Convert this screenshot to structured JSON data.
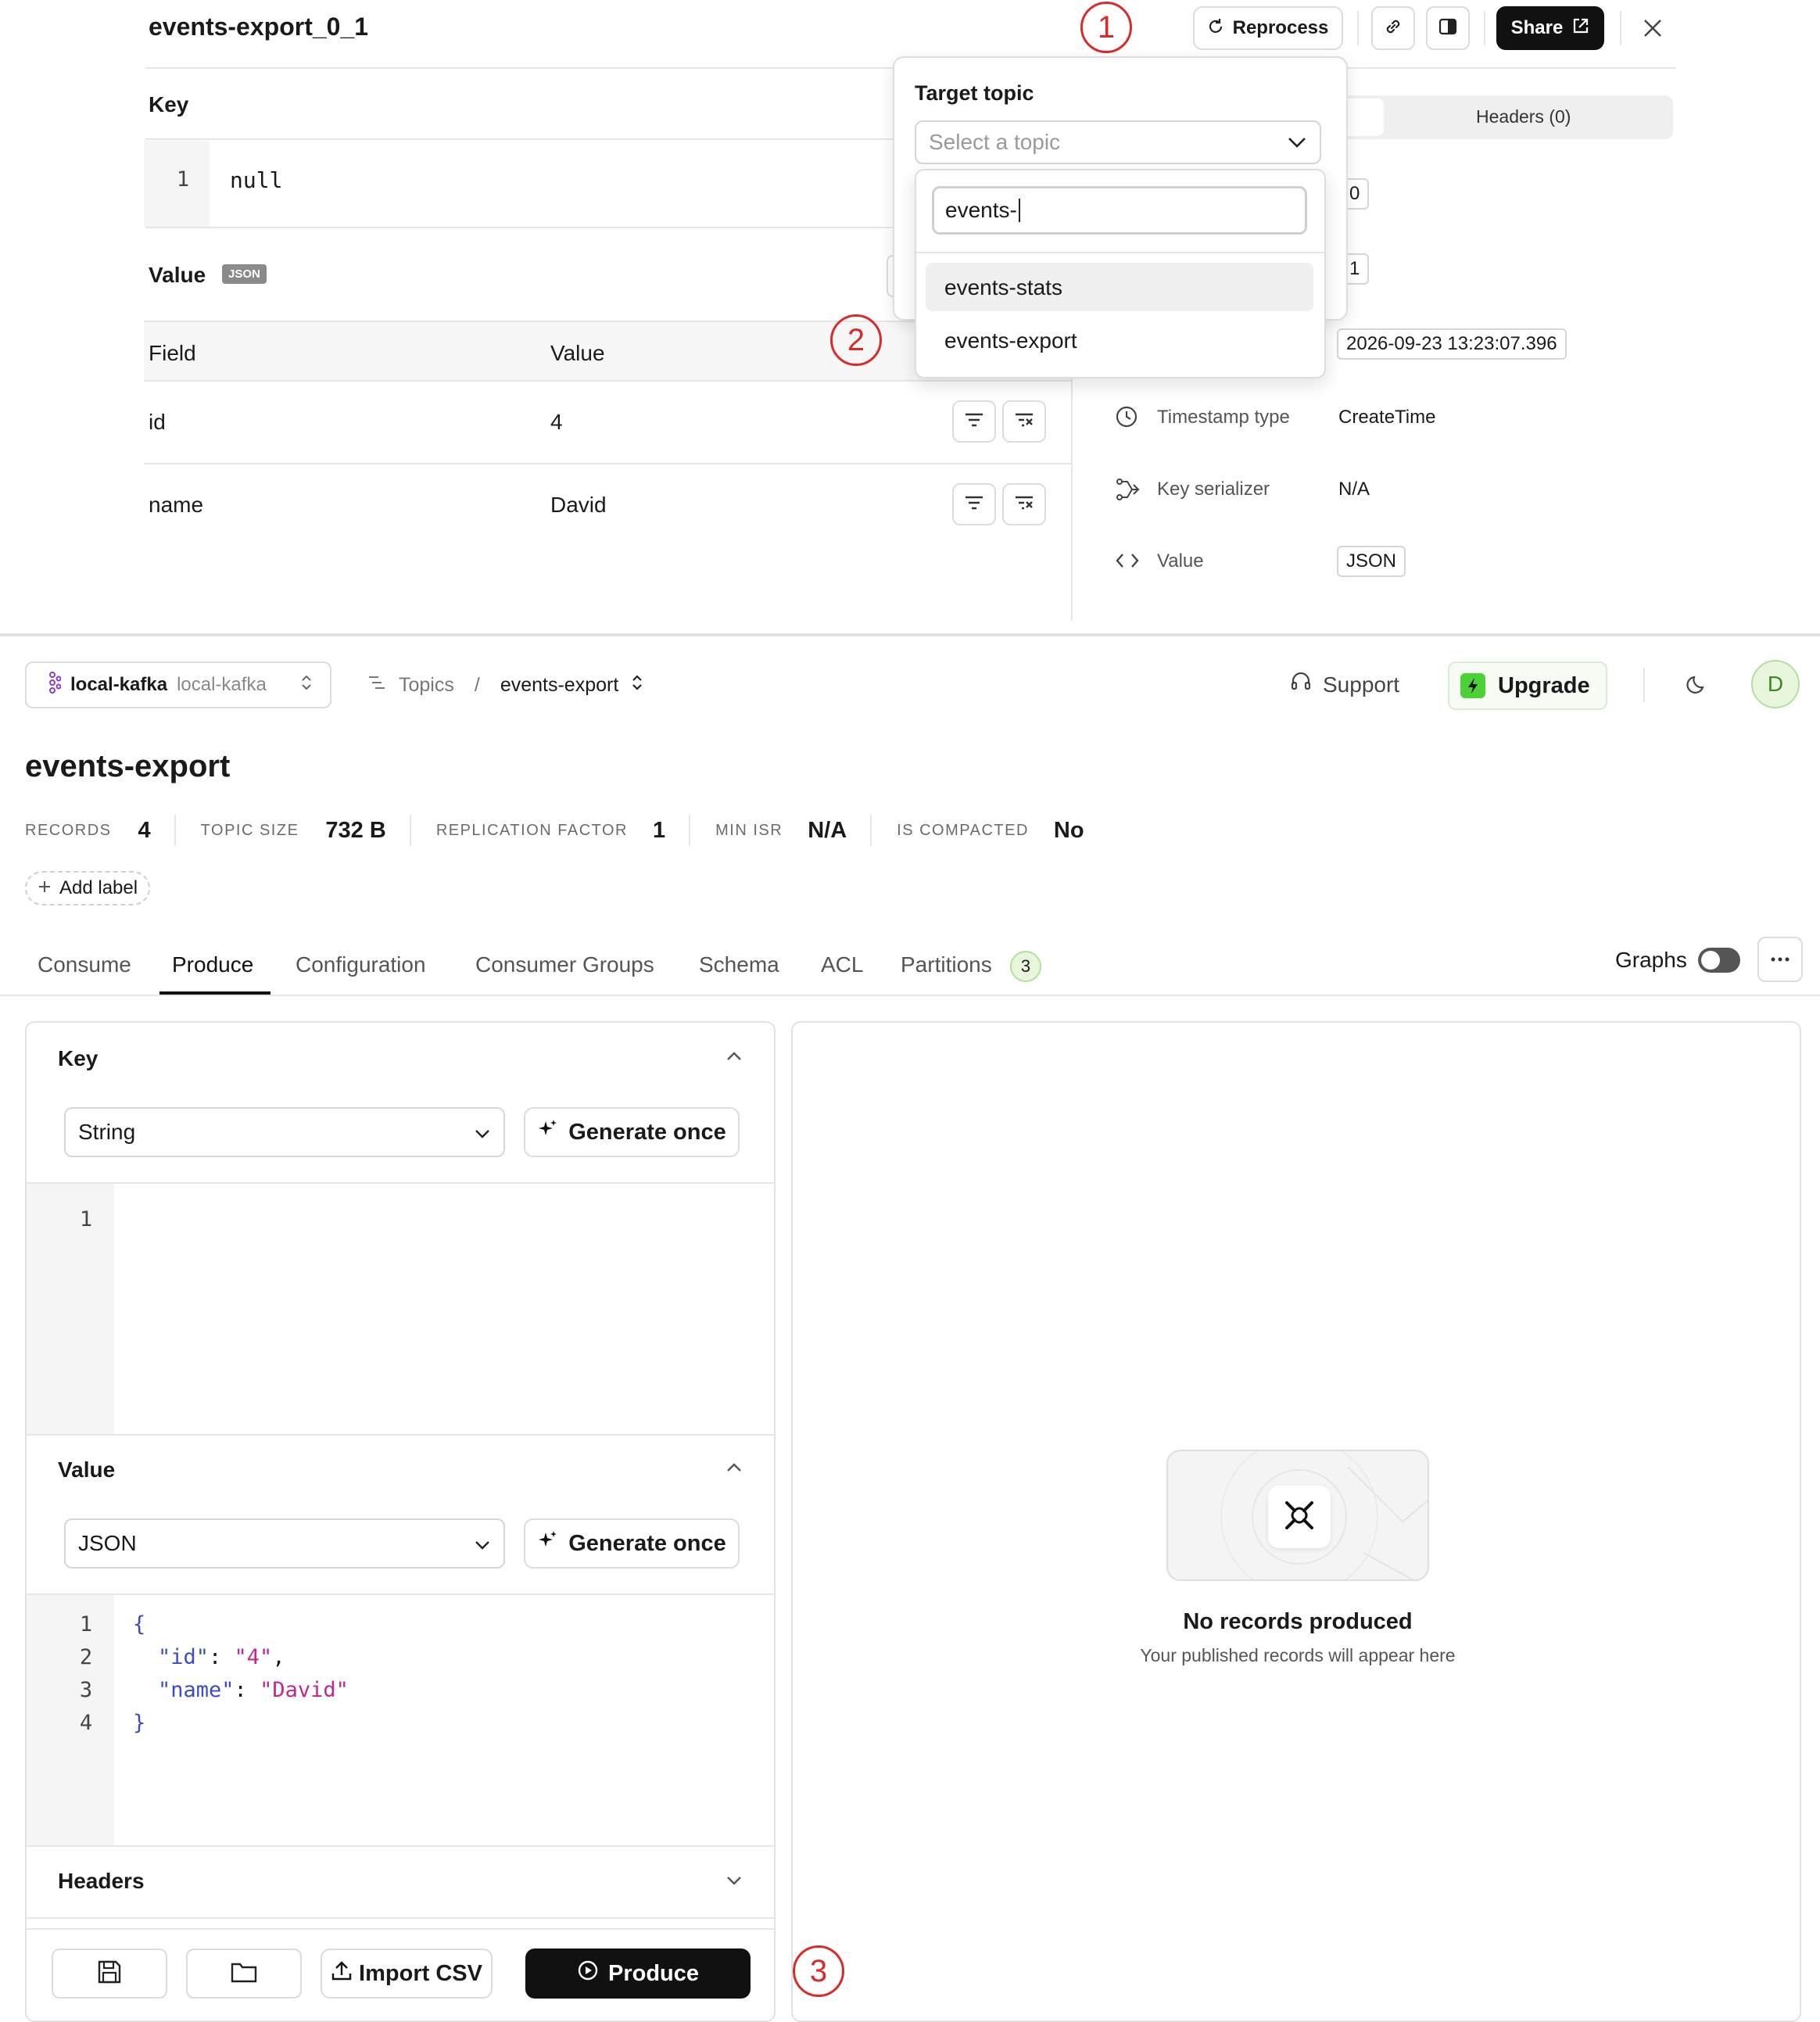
{
  "record_panel": {
    "title": "events-export_0_1",
    "reprocess_label": "Reprocess",
    "share_label": "Share",
    "key_heading": "Key",
    "key_line_number": "1",
    "key_value": "null",
    "value_heading": "Value",
    "value_badge": "JSON",
    "table_headers": [
      "Field",
      "Value"
    ],
    "rows": [
      {
        "field": "id",
        "value": "4"
      },
      {
        "field": "name",
        "value": "David"
      }
    ],
    "headers_tab": "Headers (0)",
    "meta": {
      "partition_value": "0",
      "offset_value": "1",
      "timestamp_value": "2026-09-23 13:23:07.396",
      "timestamp_type_label": "Timestamp type",
      "timestamp_type_value": "CreateTime",
      "key_serializer_label": "Key serializer",
      "key_serializer_value": "N/A",
      "value_label": "Value",
      "value_value": "JSON"
    }
  },
  "reprocess_popover": {
    "label": "Target topic",
    "placeholder": "Select a topic",
    "search_value": "events-",
    "options": [
      "events-stats",
      "events-export"
    ]
  },
  "callouts": [
    "1",
    "2",
    "3"
  ],
  "topbar": {
    "cluster_name": "local-kafka",
    "cluster_sub": "local-kafka",
    "breadcrumb_topics": "Topics",
    "breadcrumb_sep": "/",
    "breadcrumb_topic": "events-export",
    "support_label": "Support",
    "upgrade_label": "Upgrade",
    "avatar_initial": "D"
  },
  "topic": {
    "title": "events-export",
    "stats": [
      {
        "label": "RECORDS",
        "value": "4"
      },
      {
        "label": "TOPIC SIZE",
        "value": "732 B"
      },
      {
        "label": "REPLICATION FACTOR",
        "value": "1"
      },
      {
        "label": "MIN ISR",
        "value": "N/A"
      },
      {
        "label": "IS COMPACTED",
        "value": "No"
      }
    ],
    "add_label": "Add label"
  },
  "tabs": {
    "items": [
      "Consume",
      "Produce",
      "Configuration",
      "Consumer Groups",
      "Schema",
      "ACL",
      "Partitions"
    ],
    "active": "Produce",
    "partitions_count": "3",
    "graphs_label": "Graphs"
  },
  "produce": {
    "key_title": "Key",
    "key_format": "String",
    "generate_label": "Generate once",
    "key_line": "1",
    "value_title": "Value",
    "value_format": "JSON",
    "value_lines": [
      "1",
      "2",
      "3",
      "4"
    ],
    "value_code": {
      "open": "{",
      "id_key": "\"id\"",
      "id_val": "\"4\"",
      "name_key": "\"name\"",
      "name_val": "\"David\"",
      "close": "}"
    },
    "headers_title": "Headers",
    "import_label": "Import CSV",
    "produce_label": "Produce"
  },
  "empty_state": {
    "title": "No records produced",
    "subtitle": "Your published records will appear here"
  },
  "colors": {
    "accent_dark": "#111111",
    "callout_red": "#d92b2b",
    "upgrade_green": "#4cd137",
    "json_key": "#3b4bc8",
    "json_string": "#c2288a"
  }
}
